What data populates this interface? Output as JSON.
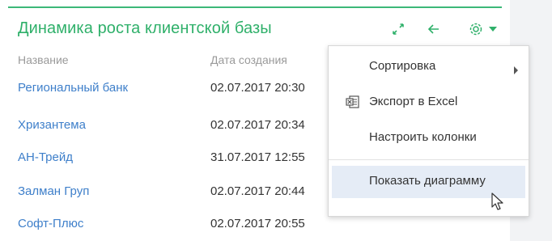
{
  "widget": {
    "title": "Динамика роста клиентской базы",
    "accent_color": "#3cb878",
    "tools": [
      "expand-icon",
      "back-arrow-icon",
      "gear-icon",
      "caret-down-icon"
    ]
  },
  "table": {
    "columns": [
      "Название",
      "Дата создания"
    ],
    "rows": [
      {
        "name": "Региональный банк",
        "date": "02.07.2017 20:30"
      },
      {
        "name": "Хризантема",
        "date": "02.07.2017 20:34"
      },
      {
        "name": "АН-Трейд",
        "date": "31.07.2017 12:55"
      },
      {
        "name": "Залман Груп",
        "date": "02.07.2017 20:44"
      },
      {
        "name": "Софт-Плюс",
        "date": "02.07.2017 20:55"
      }
    ]
  },
  "menu": {
    "items": [
      {
        "label": "Сортировка",
        "icon": "submenu-arrow-icon"
      },
      {
        "label": "Экспорт в Excel",
        "icon": "excel-icon"
      },
      {
        "label": "Настроить колонки"
      },
      {
        "label": "Показать диаграмму",
        "hovered": true
      }
    ]
  }
}
